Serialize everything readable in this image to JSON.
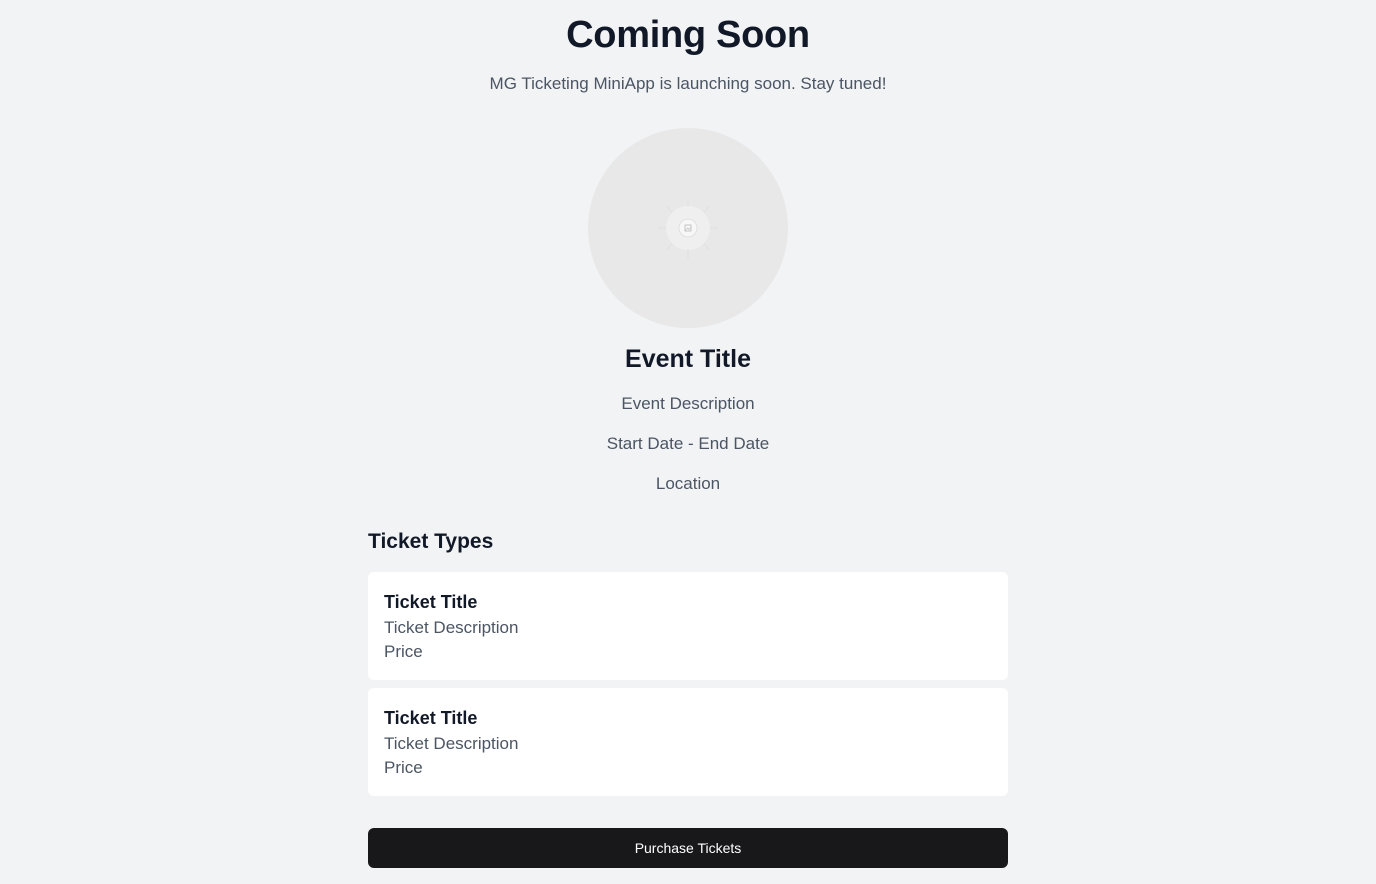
{
  "hero": {
    "title": "Coming Soon",
    "subtitle": "MG Ticketing MiniApp is launching soon. Stay tuned!"
  },
  "event": {
    "image_icon": "image-placeholder-icon",
    "title": "Event Title",
    "description": "Event Description",
    "dates": "Start Date - End Date",
    "location": "Location"
  },
  "tickets": {
    "section_title": "Ticket Types",
    "items": [
      {
        "title": "Ticket Title",
        "description": "Ticket Description",
        "price": "Price"
      },
      {
        "title": "Ticket Title",
        "description": "Ticket Description",
        "price": "Price"
      }
    ]
  },
  "actions": {
    "purchase_label": "Purchase Tickets"
  },
  "colors": {
    "background": "#f2f3f5",
    "primary_button": "#18181b",
    "card": "#ffffff",
    "text_primary": "#111827",
    "text_secondary": "#4b5563"
  }
}
